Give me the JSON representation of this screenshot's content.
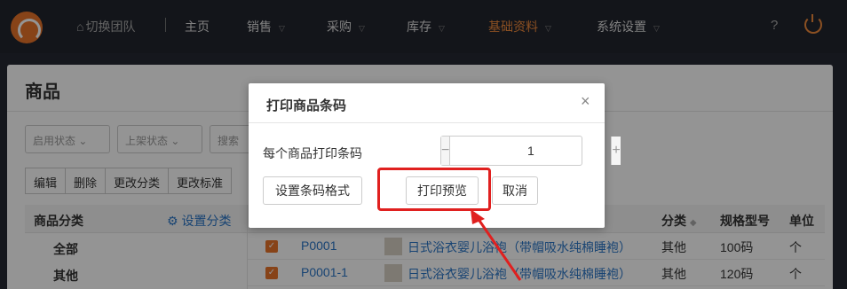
{
  "nav": {
    "team_label": "切换团队",
    "items": [
      {
        "label": "主页",
        "has_caret": false
      },
      {
        "label": "销售",
        "has_caret": true
      },
      {
        "label": "采购",
        "has_caret": true
      },
      {
        "label": "库存",
        "has_caret": true
      },
      {
        "label": "基础资料",
        "has_caret": true,
        "active": true
      },
      {
        "label": "系统设置",
        "has_caret": true
      }
    ],
    "help": "?",
    "accent_color": "#f08a3c"
  },
  "page": {
    "title": "商品",
    "filters": [
      "启用状态",
      "上架状态",
      "搜索"
    ],
    "toolbar": [
      "编辑",
      "删除",
      "更改分类",
      "更改标准"
    ],
    "category_panel": {
      "title": "商品分类",
      "setting_label": "设置分类",
      "rows": [
        "全部",
        "其他"
      ]
    },
    "table": {
      "headers": {
        "category": "分类",
        "spec": "规格型号",
        "unit": "单位"
      },
      "rows": [
        {
          "code": "P0001",
          "name": "日式浴衣婴儿浴袍（带帽吸水纯棉睡袍）",
          "category": "其他",
          "spec": "100码",
          "unit": "个"
        },
        {
          "code": "P0001-1",
          "name": "日式浴衣婴儿浴袍（带帽吸水纯棉睡袍）",
          "category": "其他",
          "spec": "120码",
          "unit": "个"
        }
      ]
    }
  },
  "modal": {
    "title": "打印商品条码",
    "close": "×",
    "qty_label": "每个商品打印条码",
    "qty_value": "1",
    "minus": "−",
    "plus": "+",
    "format_button": "设置条码格式",
    "preview_button": "打印预览",
    "cancel_button": "取消"
  },
  "annotation_color": "#e0201f"
}
